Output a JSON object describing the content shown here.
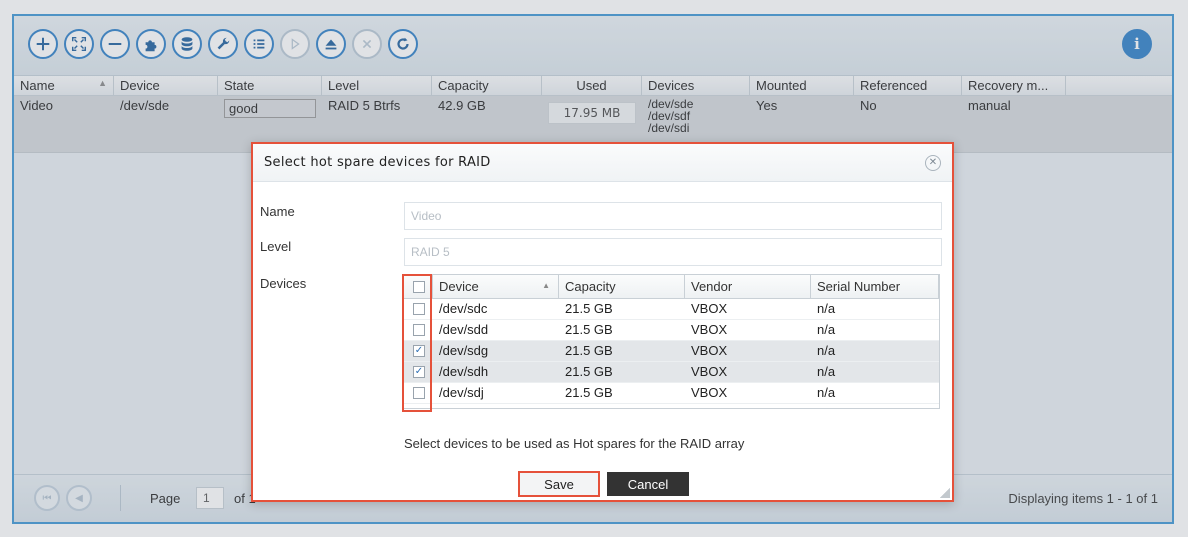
{
  "grid": {
    "columns": [
      "Name",
      "Device",
      "State",
      "Level",
      "Capacity",
      "Used",
      "Devices",
      "Mounted",
      "Referenced",
      "Recovery m..."
    ],
    "row": {
      "name": "Video",
      "device": "/dev/sde",
      "state": "good",
      "level": "RAID 5 Btrfs",
      "capacity": "42.9 GB",
      "used": "17.95 MB",
      "devices": [
        "/dev/sde",
        "/dev/sdf",
        "/dev/sdi"
      ],
      "mounted": "Yes",
      "referenced": "No",
      "recovery": "manual"
    }
  },
  "toolbar": {
    "icons": [
      "add-icon",
      "expand-icon",
      "remove-icon",
      "puzzle-icon",
      "database-icon",
      "wrench-icon",
      "list-icon",
      "play-icon",
      "eject-icon",
      "close-icon",
      "refresh-icon",
      "info-icon"
    ]
  },
  "pager": {
    "page_label": "Page",
    "page_value": "1",
    "of_label": "of 1",
    "displaying": "Displaying items 1 - 1 of 1"
  },
  "dialog": {
    "title": "Select hot spare devices for RAID",
    "name_label": "Name",
    "name_placeholder": "Video",
    "level_label": "Level",
    "level_placeholder": "RAID 5",
    "devices_label": "Devices",
    "table_headers": [
      "Device",
      "Capacity",
      "Vendor",
      "Serial Number"
    ],
    "devices": [
      {
        "device": "/dev/sdc",
        "capacity": "21.5 GB",
        "vendor": "VBOX",
        "serial": "n/a",
        "checked": false
      },
      {
        "device": "/dev/sdd",
        "capacity": "21.5 GB",
        "vendor": "VBOX",
        "serial": "n/a",
        "checked": false
      },
      {
        "device": "/dev/sdg",
        "capacity": "21.5 GB",
        "vendor": "VBOX",
        "serial": "n/a",
        "checked": true
      },
      {
        "device": "/dev/sdh",
        "capacity": "21.5 GB",
        "vendor": "VBOX",
        "serial": "n/a",
        "checked": true
      },
      {
        "device": "/dev/sdj",
        "capacity": "21.5 GB",
        "vendor": "VBOX",
        "serial": "n/a",
        "checked": false
      }
    ],
    "hint": "Select devices to be used as Hot spares for the RAID array",
    "save_label": "Save",
    "cancel_label": "Cancel"
  },
  "colors": {
    "accent": "#2d7fc8",
    "highlight": "#e5513a"
  }
}
